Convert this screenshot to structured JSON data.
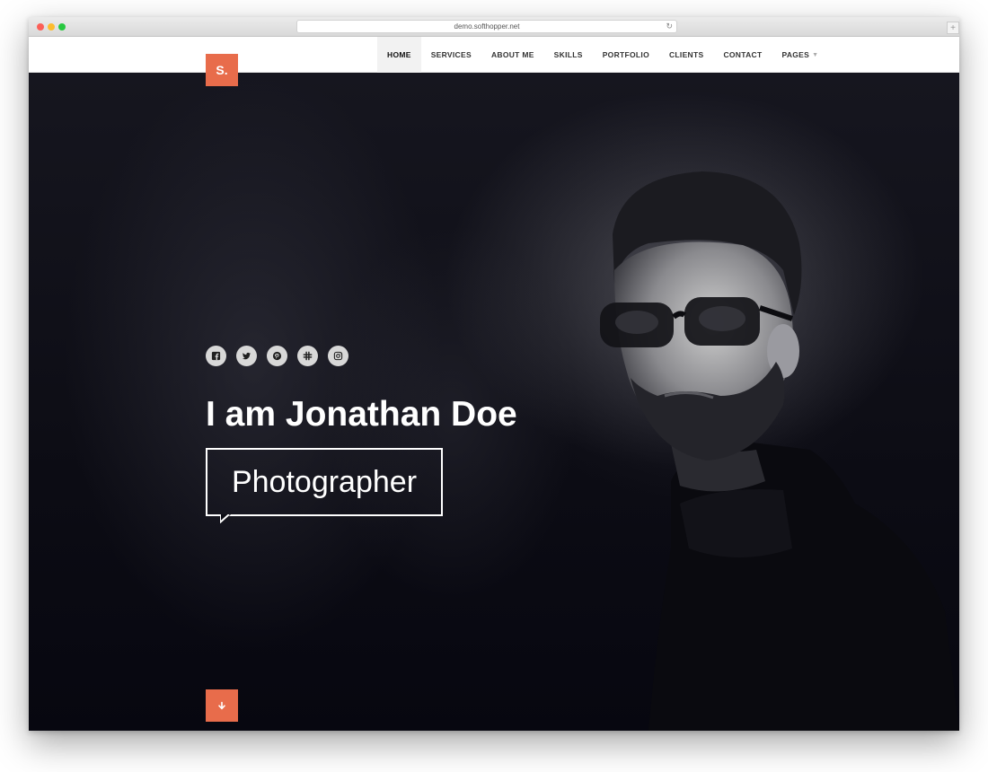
{
  "browser": {
    "url": "demo.softhopper.net",
    "reload_icon": "reload-icon",
    "new_tab_icon": "plus-icon"
  },
  "nav": {
    "items": [
      {
        "label": "HOME",
        "active": true
      },
      {
        "label": "SERVICES"
      },
      {
        "label": "ABOUT ME"
      },
      {
        "label": "SKILLS"
      },
      {
        "label": "PORTFOLIO"
      },
      {
        "label": "CLIENTS"
      },
      {
        "label": "CONTACT"
      },
      {
        "label": "PAGES",
        "has_dropdown": true
      }
    ]
  },
  "logo": {
    "text": "S."
  },
  "hero": {
    "social_icons": [
      "facebook-icon",
      "twitter-icon",
      "pinterest-icon",
      "slack-icon",
      "instagram-icon"
    ],
    "headline": "I am Jonathan Doe",
    "role": "Photographer",
    "scroll_icon": "arrow-down-icon",
    "image": "monochrome portrait of a bearded man wearing glasses and a black turtleneck"
  },
  "colors": {
    "accent": "#e86c4b",
    "hero_background": "#0b0b14",
    "nav_text": "#333333"
  }
}
